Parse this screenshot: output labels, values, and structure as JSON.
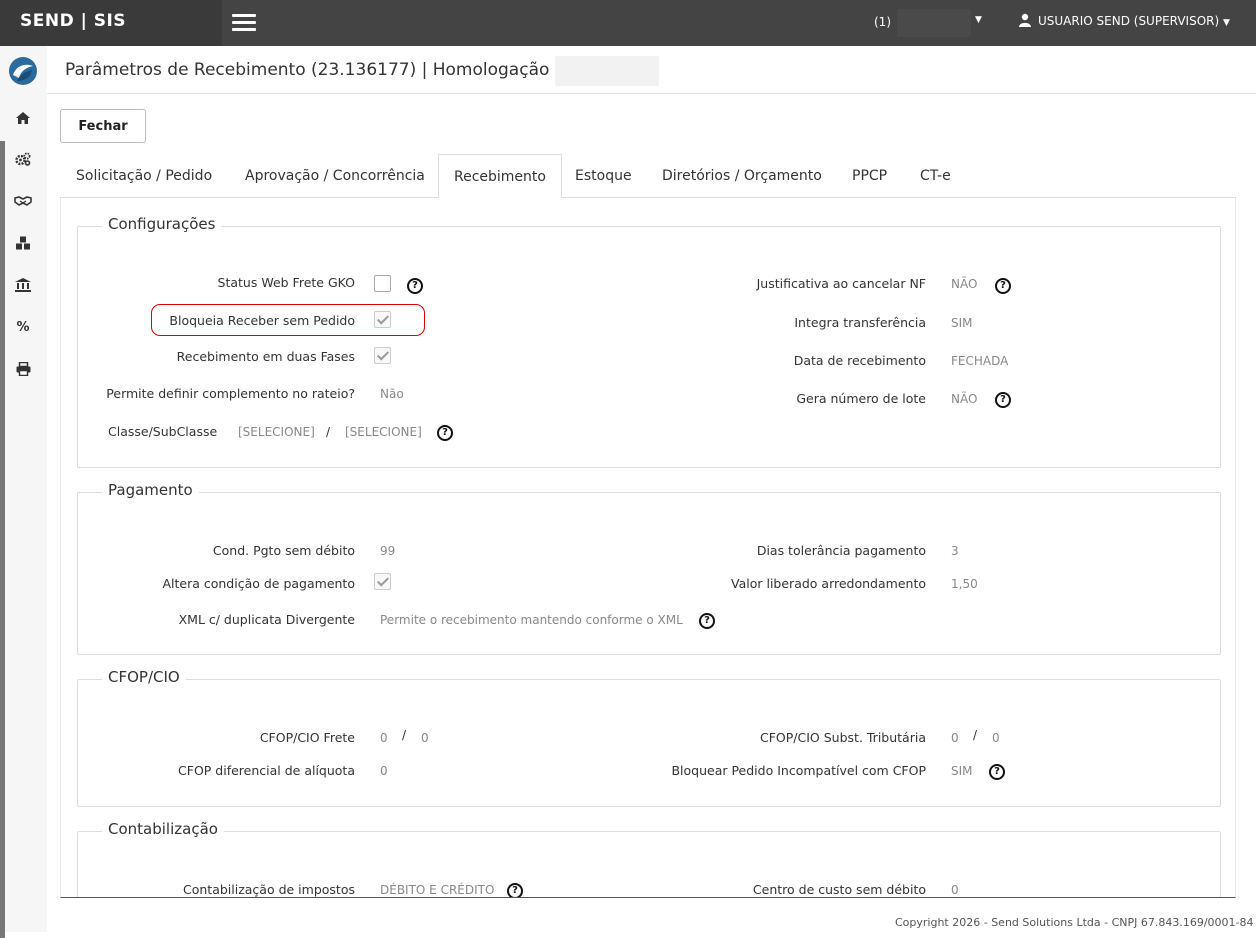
{
  "app": {
    "brand": "SEND | SIS"
  },
  "topbar": {
    "company_label": "(1)",
    "user_label": "USUARIO SEND (SUPERVISOR)"
  },
  "sidebar": {
    "items": [
      "home-icon",
      "gears-icon",
      "handshake-icon",
      "cubes-icon",
      "bank-icon",
      "percent-icon",
      "print-icon"
    ]
  },
  "header": {
    "title": "Parâmetros de Recebimento (23.136177) | Homologação |"
  },
  "toolbar": {
    "close_label": "Fechar"
  },
  "tabs": [
    {
      "label": "Solicitação / Pedido"
    },
    {
      "label": "Aprovação / Concorrência"
    },
    {
      "label": "Recebimento",
      "active": true
    },
    {
      "label": "Estoque"
    },
    {
      "label": "Diretórios / Orçamento"
    },
    {
      "label": "PPCP"
    },
    {
      "label": "CT-e"
    }
  ],
  "sections": {
    "config": {
      "legend": "Configurações",
      "status_web_frete": {
        "label": "Status Web Frete GKO",
        "checked": false
      },
      "bloqueia": {
        "label": "Bloqueia Receber sem Pedido",
        "checked": true
      },
      "recebimento_duas_fases": {
        "label": "Recebimento em duas Fases",
        "checked": true
      },
      "complemento_rateio": {
        "label": "Permite definir complemento no rateio?",
        "value": "Não"
      },
      "classe": {
        "label": "Classe/SubClasse",
        "value1": "[SELECIONE]",
        "sep": "/",
        "value2": "[SELECIONE]"
      },
      "justificativa": {
        "label": "Justificativa ao cancelar NF",
        "value": "NÃO"
      },
      "integra": {
        "label": "Integra transferência",
        "value": "SIM"
      },
      "data_recebimento": {
        "label": "Data de recebimento",
        "value": "FECHADA"
      },
      "gera_lote": {
        "label": "Gera número de lote",
        "value": "NÃO"
      }
    },
    "pagamento": {
      "legend": "Pagamento",
      "cond_pgto": {
        "label": "Cond. Pgto sem débito",
        "value": "99"
      },
      "altera_condicao": {
        "label": "Altera condição de pagamento",
        "checked": true
      },
      "xml_duplicata": {
        "label": "XML c/ duplicata Divergente",
        "value": "Permite o recebimento mantendo conforme o XML"
      },
      "dias_tolerancia": {
        "label": "Dias tolerância pagamento",
        "value": "3"
      },
      "valor_liberado": {
        "label": "Valor liberado arredondamento",
        "value": "1,50"
      }
    },
    "cfop": {
      "legend": "CFOP/CIO",
      "frete": {
        "label": "CFOP/CIO Frete",
        "value1": "0",
        "sep": "/",
        "value2": "0"
      },
      "diferencial": {
        "label": "CFOP diferencial de alíquota",
        "value": "0"
      },
      "subst": {
        "label": "CFOP/CIO Subst. Tributária",
        "value1": "0",
        "sep": "/",
        "value2": "0"
      },
      "bloquear": {
        "label": "Bloquear Pedido Incompatível com CFOP",
        "value": "SIM"
      }
    },
    "contab": {
      "legend": "Contabilização",
      "impostos": {
        "label": "Contabilização de impostos",
        "value": "DÉBITO E CRÉDITO"
      },
      "centro_custo": {
        "label": "Centro de custo sem débito",
        "value": "0"
      }
    }
  },
  "footer": {
    "text": "Copyright 2026 - Send Solutions Ltda - CNPJ 67.843.169/0001-84"
  },
  "colors": {
    "topbar": "#444444",
    "highlight": "#dd0000"
  }
}
